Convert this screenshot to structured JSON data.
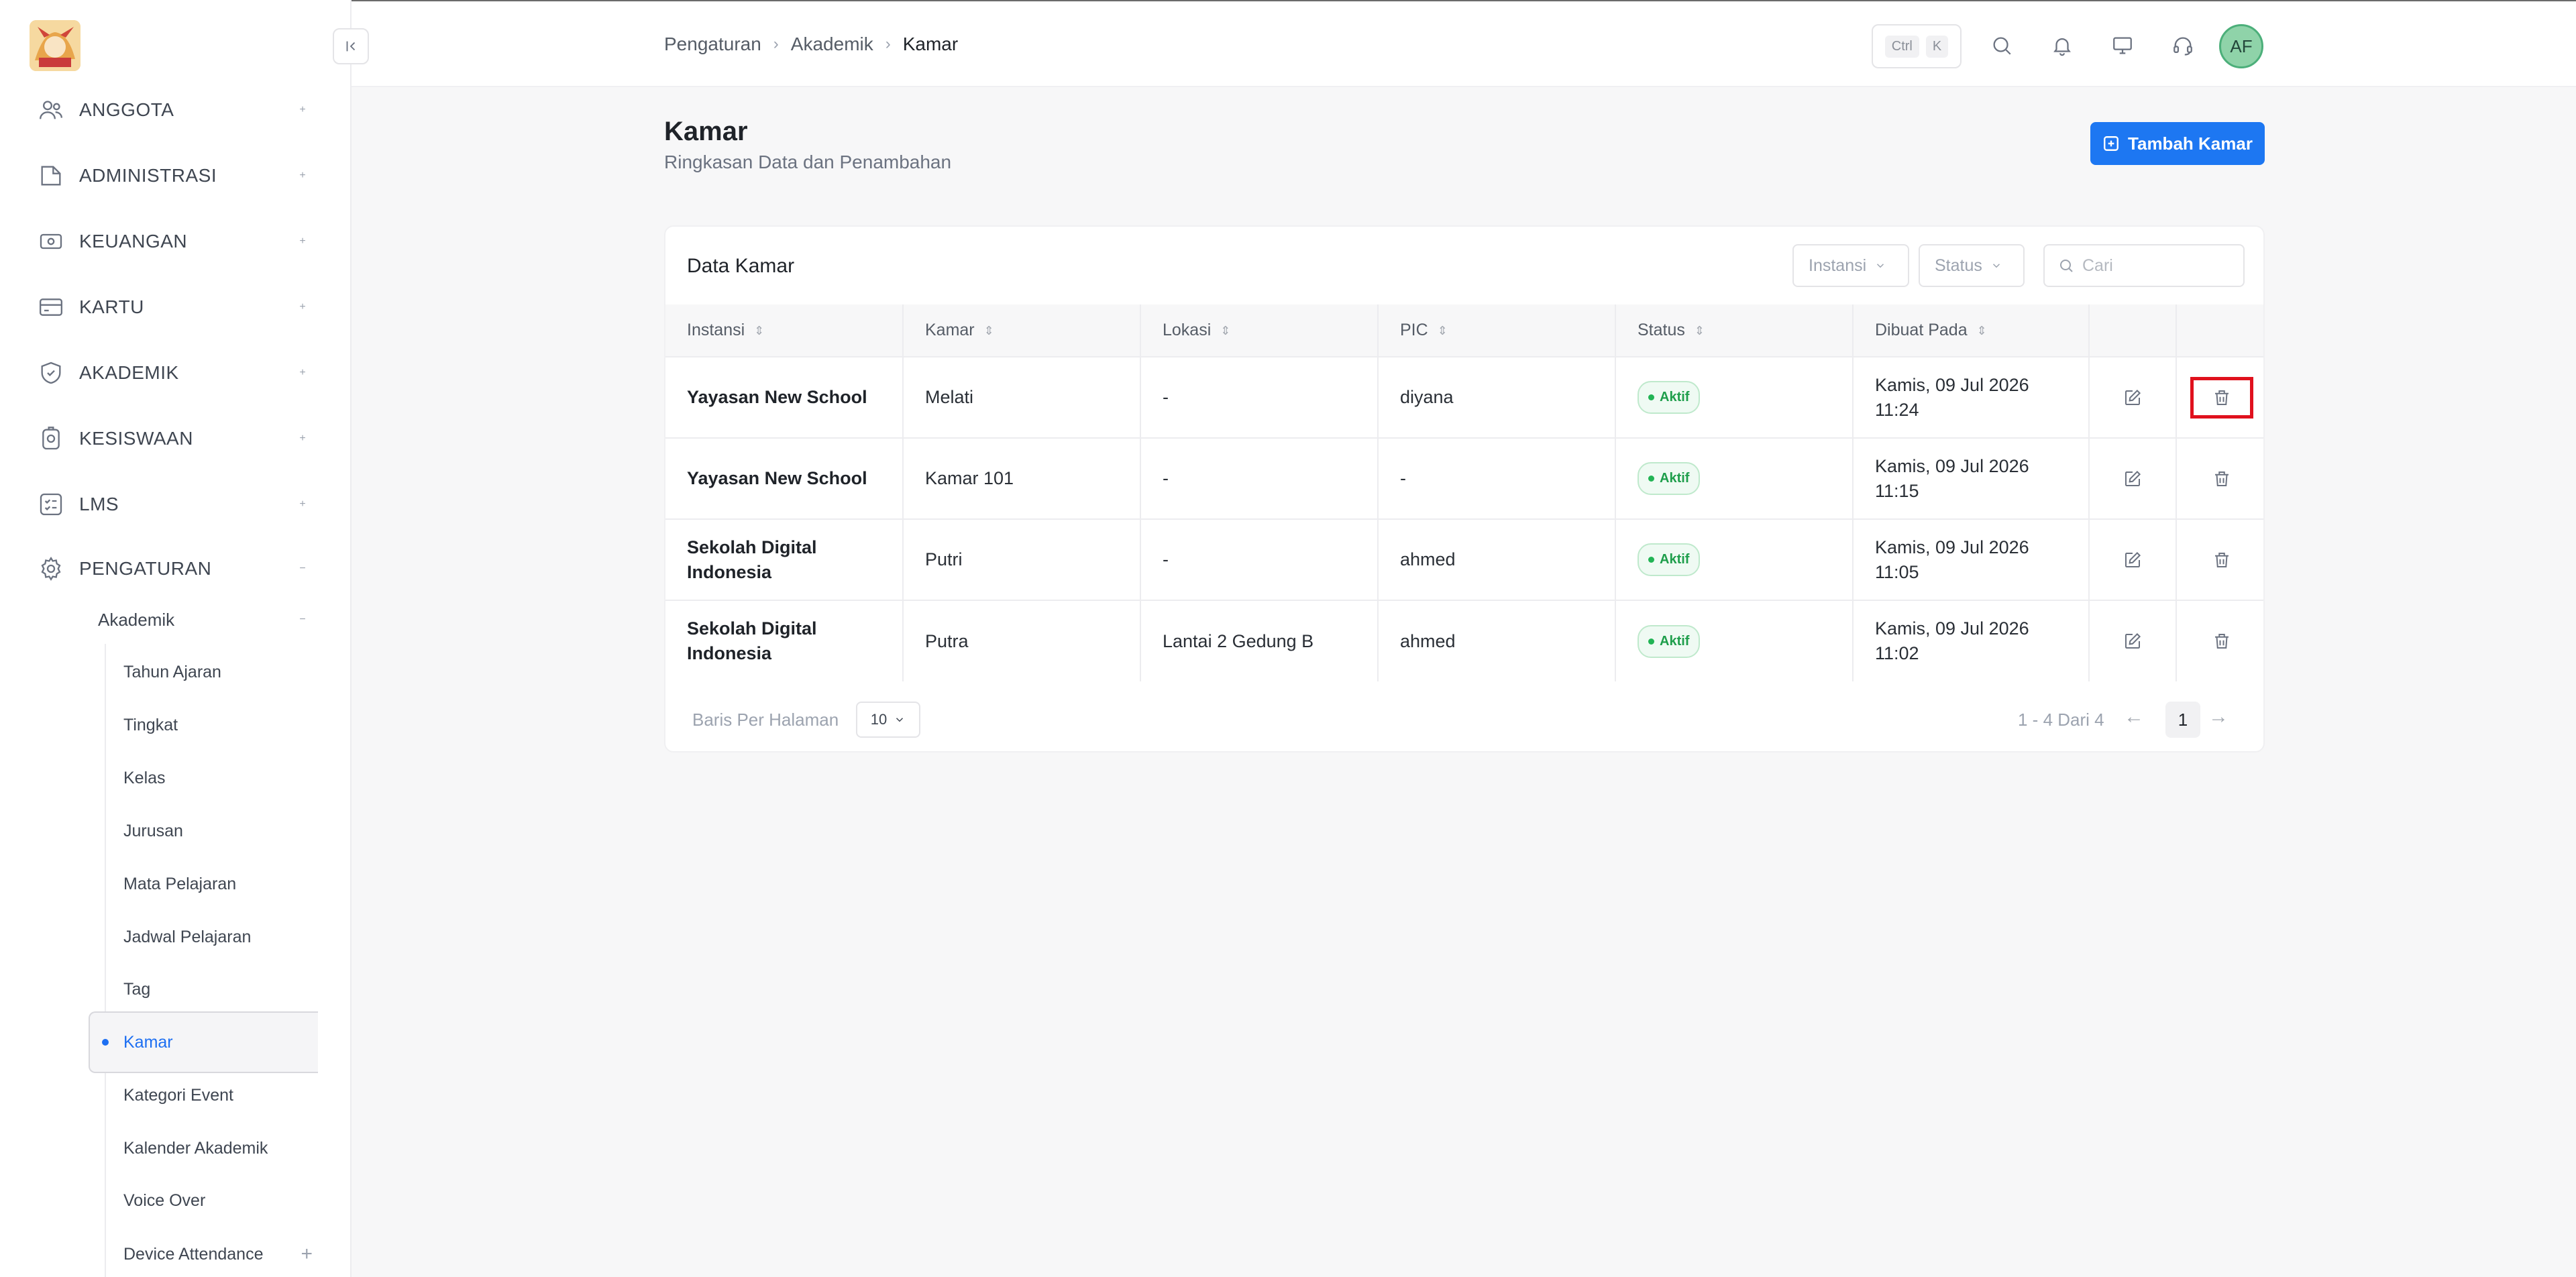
{
  "sidebar": {
    "groups": [
      {
        "label": "ANGGOTA",
        "icon": "users-icon",
        "toggle": "+"
      },
      {
        "label": "ADMINISTRASI",
        "icon": "folder-icon",
        "toggle": "+"
      },
      {
        "label": "KEUANGAN",
        "icon": "money-icon",
        "toggle": "+"
      },
      {
        "label": "KARTU",
        "icon": "card-icon",
        "toggle": "+"
      },
      {
        "label": "AKADEMIK",
        "icon": "shield-icon",
        "toggle": "+"
      },
      {
        "label": "KESISWAAN",
        "icon": "badge-icon",
        "toggle": "+"
      },
      {
        "label": "LMS",
        "icon": "list-icon",
        "toggle": "+"
      },
      {
        "label": "PENGATURAN",
        "icon": "gear-icon",
        "toggle": "−"
      }
    ],
    "sub_parent": {
      "label": "Akademik",
      "toggle": "−"
    },
    "sub_items": [
      "Tahun Ajaran",
      "Tingkat",
      "Kelas",
      "Jurusan",
      "Mata Pelajaran",
      "Jadwal Pelajaran",
      "Tag",
      "Kamar",
      "Kategori Event",
      "Kalender Akademik",
      "Voice Over",
      "Device Attendance"
    ],
    "active_item": "Kamar",
    "last_toggle": "+"
  },
  "header": {
    "breadcrumb": [
      "Pengaturan",
      "Akademik",
      "Kamar"
    ],
    "kbd": [
      "Ctrl",
      "K"
    ],
    "avatar_initials": "AF"
  },
  "page": {
    "title": "Kamar",
    "subtitle": "Ringkasan Data dan Penambahan",
    "add_button": "Tambah Kamar"
  },
  "card": {
    "title": "Data Kamar",
    "filter_instansi": "Instansi",
    "filter_status": "Status",
    "search_placeholder": "Cari"
  },
  "table": {
    "columns": [
      "Instansi",
      "Kamar",
      "Lokasi",
      "PIC",
      "Status",
      "Dibuat Pada"
    ],
    "rows": [
      {
        "instansi": "Yayasan New School",
        "kamar": "Melati",
        "lokasi": "-",
        "pic": "diyana",
        "status": "Aktif",
        "dibuat_1": "Kamis, 09 Jul 2026",
        "dibuat_2": "11:24"
      },
      {
        "instansi": "Yayasan New School",
        "kamar": "Kamar 101",
        "lokasi": "-",
        "pic": "-",
        "status": "Aktif",
        "dibuat_1": "Kamis, 09 Jul 2026",
        "dibuat_2": "11:15"
      },
      {
        "instansi_1": "Sekolah Digital",
        "instansi_2": "Indonesia",
        "kamar": "Putri",
        "lokasi": "-",
        "pic": "ahmed",
        "status": "Aktif",
        "dibuat_1": "Kamis, 09 Jul 2026",
        "dibuat_2": "11:05"
      },
      {
        "instansi_1": "Sekolah Digital",
        "instansi_2": "Indonesia",
        "kamar": "Putra",
        "lokasi": "Lantai 2 Gedung B",
        "pic": "ahmed",
        "status": "Aktif",
        "dibuat_1": "Kamis, 09 Jul 2026",
        "dibuat_2": "11:02"
      }
    ]
  },
  "pagination": {
    "rows_label": "Baris Per Halaman",
    "rows_value": "10",
    "range": "1 - 4 Dari 4",
    "current_page": "1",
    "prev": "←",
    "next": "→"
  },
  "colors": {
    "primary": "#1d77f2",
    "active_link": "#1d6ff2",
    "status_green": "#1e9e4b",
    "highlight_red": "#e0111d"
  }
}
